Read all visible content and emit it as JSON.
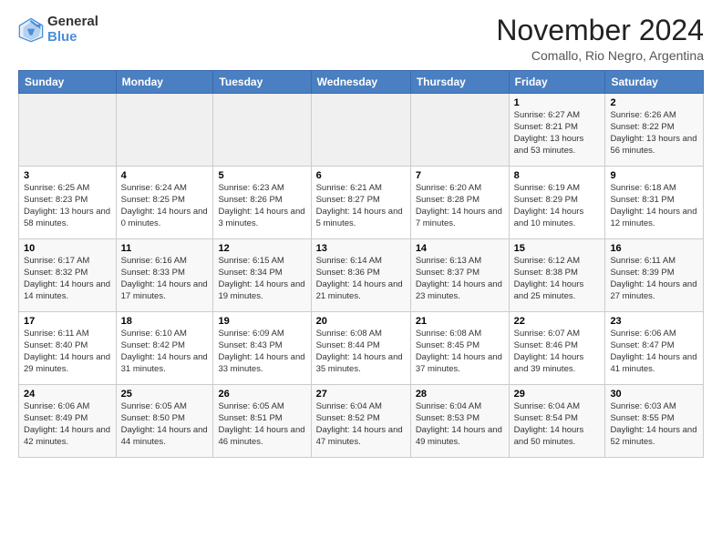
{
  "logo": {
    "general": "General",
    "blue": "Blue"
  },
  "header": {
    "month": "November 2024",
    "location": "Comallo, Rio Negro, Argentina"
  },
  "weekdays": [
    "Sunday",
    "Monday",
    "Tuesday",
    "Wednesday",
    "Thursday",
    "Friday",
    "Saturday"
  ],
  "weeks": [
    [
      {
        "day": "",
        "empty": true
      },
      {
        "day": "",
        "empty": true
      },
      {
        "day": "",
        "empty": true
      },
      {
        "day": "",
        "empty": true
      },
      {
        "day": "",
        "empty": true
      },
      {
        "day": "1",
        "sunrise": "6:27 AM",
        "sunset": "8:21 PM",
        "daylight": "13 hours and 53 minutes."
      },
      {
        "day": "2",
        "sunrise": "6:26 AM",
        "sunset": "8:22 PM",
        "daylight": "13 hours and 56 minutes."
      }
    ],
    [
      {
        "day": "3",
        "sunrise": "6:25 AM",
        "sunset": "8:23 PM",
        "daylight": "13 hours and 58 minutes."
      },
      {
        "day": "4",
        "sunrise": "6:24 AM",
        "sunset": "8:25 PM",
        "daylight": "14 hours and 0 minutes."
      },
      {
        "day": "5",
        "sunrise": "6:23 AM",
        "sunset": "8:26 PM",
        "daylight": "14 hours and 3 minutes."
      },
      {
        "day": "6",
        "sunrise": "6:21 AM",
        "sunset": "8:27 PM",
        "daylight": "14 hours and 5 minutes."
      },
      {
        "day": "7",
        "sunrise": "6:20 AM",
        "sunset": "8:28 PM",
        "daylight": "14 hours and 7 minutes."
      },
      {
        "day": "8",
        "sunrise": "6:19 AM",
        "sunset": "8:29 PM",
        "daylight": "14 hours and 10 minutes."
      },
      {
        "day": "9",
        "sunrise": "6:18 AM",
        "sunset": "8:31 PM",
        "daylight": "14 hours and 12 minutes."
      }
    ],
    [
      {
        "day": "10",
        "sunrise": "6:17 AM",
        "sunset": "8:32 PM",
        "daylight": "14 hours and 14 minutes."
      },
      {
        "day": "11",
        "sunrise": "6:16 AM",
        "sunset": "8:33 PM",
        "daylight": "14 hours and 17 minutes."
      },
      {
        "day": "12",
        "sunrise": "6:15 AM",
        "sunset": "8:34 PM",
        "daylight": "14 hours and 19 minutes."
      },
      {
        "day": "13",
        "sunrise": "6:14 AM",
        "sunset": "8:36 PM",
        "daylight": "14 hours and 21 minutes."
      },
      {
        "day": "14",
        "sunrise": "6:13 AM",
        "sunset": "8:37 PM",
        "daylight": "14 hours and 23 minutes."
      },
      {
        "day": "15",
        "sunrise": "6:12 AM",
        "sunset": "8:38 PM",
        "daylight": "14 hours and 25 minutes."
      },
      {
        "day": "16",
        "sunrise": "6:11 AM",
        "sunset": "8:39 PM",
        "daylight": "14 hours and 27 minutes."
      }
    ],
    [
      {
        "day": "17",
        "sunrise": "6:11 AM",
        "sunset": "8:40 PM",
        "daylight": "14 hours and 29 minutes."
      },
      {
        "day": "18",
        "sunrise": "6:10 AM",
        "sunset": "8:42 PM",
        "daylight": "14 hours and 31 minutes."
      },
      {
        "day": "19",
        "sunrise": "6:09 AM",
        "sunset": "8:43 PM",
        "daylight": "14 hours and 33 minutes."
      },
      {
        "day": "20",
        "sunrise": "6:08 AM",
        "sunset": "8:44 PM",
        "daylight": "14 hours and 35 minutes."
      },
      {
        "day": "21",
        "sunrise": "6:08 AM",
        "sunset": "8:45 PM",
        "daylight": "14 hours and 37 minutes."
      },
      {
        "day": "22",
        "sunrise": "6:07 AM",
        "sunset": "8:46 PM",
        "daylight": "14 hours and 39 minutes."
      },
      {
        "day": "23",
        "sunrise": "6:06 AM",
        "sunset": "8:47 PM",
        "daylight": "14 hours and 41 minutes."
      }
    ],
    [
      {
        "day": "24",
        "sunrise": "6:06 AM",
        "sunset": "8:49 PM",
        "daylight": "14 hours and 42 minutes."
      },
      {
        "day": "25",
        "sunrise": "6:05 AM",
        "sunset": "8:50 PM",
        "daylight": "14 hours and 44 minutes."
      },
      {
        "day": "26",
        "sunrise": "6:05 AM",
        "sunset": "8:51 PM",
        "daylight": "14 hours and 46 minutes."
      },
      {
        "day": "27",
        "sunrise": "6:04 AM",
        "sunset": "8:52 PM",
        "daylight": "14 hours and 47 minutes."
      },
      {
        "day": "28",
        "sunrise": "6:04 AM",
        "sunset": "8:53 PM",
        "daylight": "14 hours and 49 minutes."
      },
      {
        "day": "29",
        "sunrise": "6:04 AM",
        "sunset": "8:54 PM",
        "daylight": "14 hours and 50 minutes."
      },
      {
        "day": "30",
        "sunrise": "6:03 AM",
        "sunset": "8:55 PM",
        "daylight": "14 hours and 52 minutes."
      }
    ]
  ]
}
